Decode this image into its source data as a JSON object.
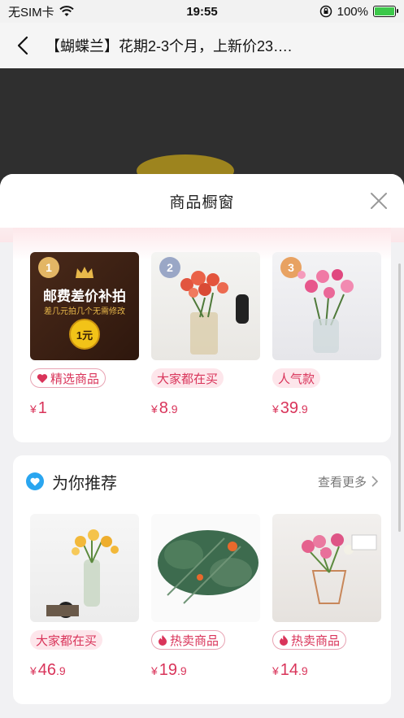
{
  "status_bar": {
    "carrier": "无SIM卡",
    "time": "19:55",
    "battery": "100%"
  },
  "nav": {
    "title": "【蝴蝶兰】花期2-3个月，上新价23…."
  },
  "sheet": {
    "title": "商品橱窗"
  },
  "showcase": {
    "products": [
      {
        "rank": "1",
        "banner_title": "邮费差价补拍",
        "banner_sub": "差几元拍几个无需修改",
        "banner_coin": "1元",
        "tag": "精选商品",
        "price_int": "1",
        "price_dec": ""
      },
      {
        "rank": "2",
        "tag": "大家都在买",
        "price_int": "8",
        "price_dec": ".9"
      },
      {
        "rank": "3",
        "tag": "人气款",
        "price_int": "39",
        "price_dec": ".9"
      }
    ]
  },
  "recommend": {
    "title": "为你推荐",
    "more": "查看更多",
    "products": [
      {
        "tag": "大家都在买",
        "price_int": "46",
        "price_dec": ".9"
      },
      {
        "tag": "热卖商品",
        "price_int": "19",
        "price_dec": ".9"
      },
      {
        "tag": "热卖商品",
        "price_int": "14",
        "price_dec": ".9"
      }
    ]
  },
  "currency": "¥",
  "colors": {
    "accent": "#d9345a",
    "tag_bg": "#fde6eb",
    "blue_icon": "#2aa6f0"
  }
}
